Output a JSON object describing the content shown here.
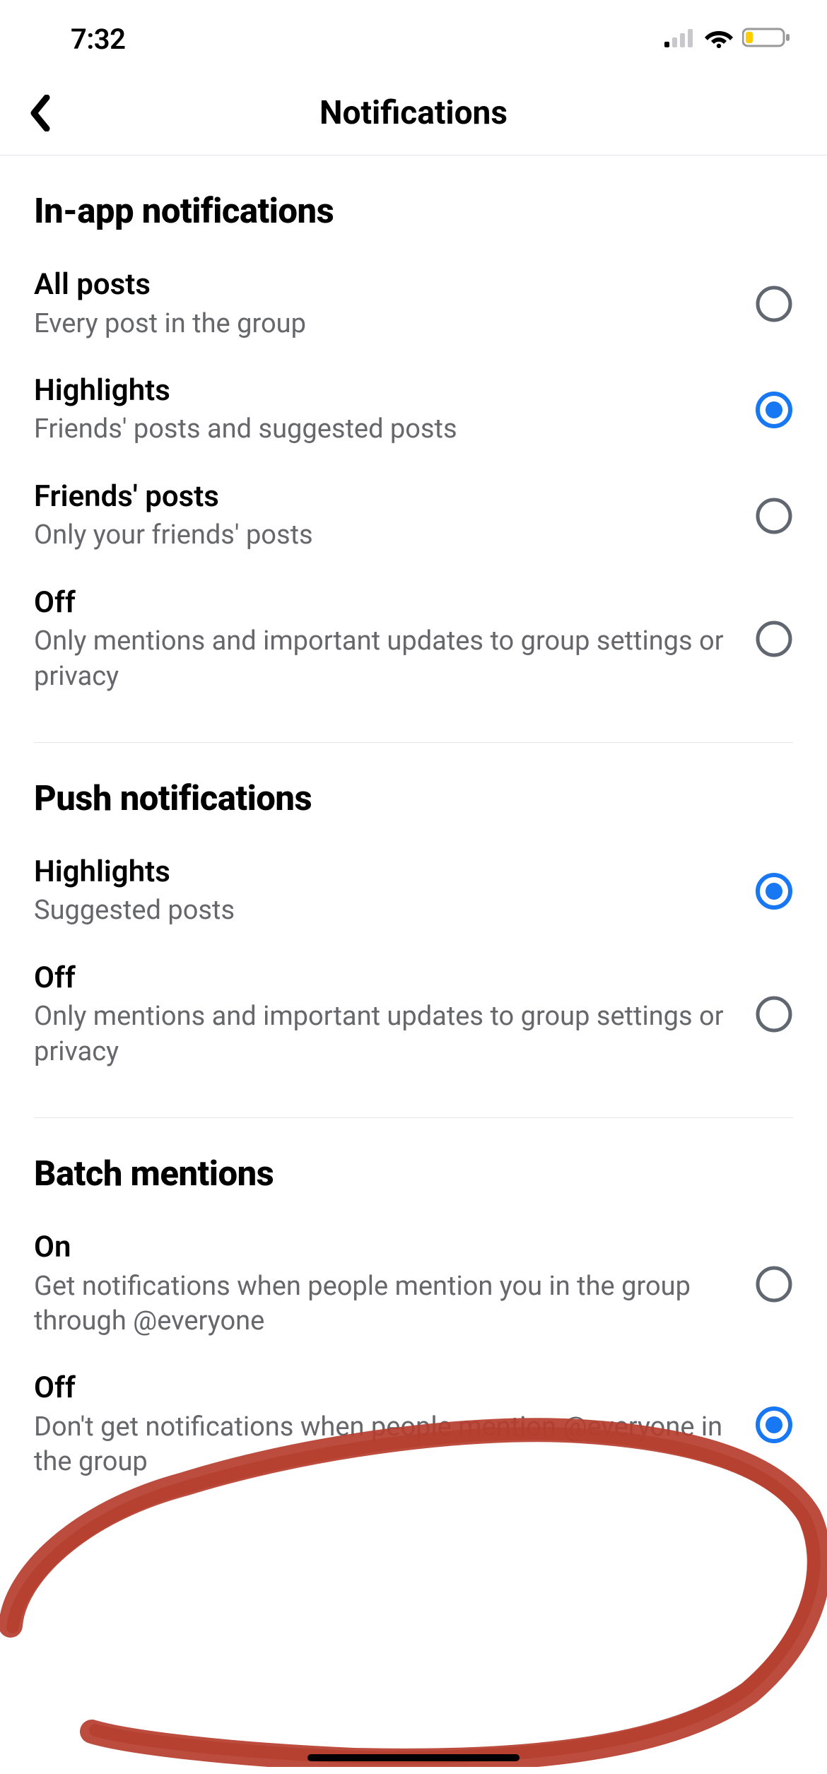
{
  "status": {
    "time": "7:32"
  },
  "nav": {
    "title": "Notifications"
  },
  "sections": {
    "inapp": {
      "title": "In-app notifications",
      "all_posts": {
        "label": "All posts",
        "desc": "Every post in the group",
        "selected": false
      },
      "highlights": {
        "label": "Highlights",
        "desc": "Friends' posts and suggested posts",
        "selected": true
      },
      "friends": {
        "label": "Friends' posts",
        "desc": "Only your friends' posts",
        "selected": false
      },
      "off": {
        "label": "Off",
        "desc": "Only mentions and important updates to group settings or privacy",
        "selected": false
      }
    },
    "push": {
      "title": "Push notifications",
      "highlights": {
        "label": "Highlights",
        "desc": "Suggested posts",
        "selected": true
      },
      "off": {
        "label": "Off",
        "desc": "Only mentions and important updates to group settings or privacy",
        "selected": false
      }
    },
    "batch": {
      "title": "Batch mentions",
      "on": {
        "label": "On",
        "desc": "Get notifications when people mention you in the group through @everyone",
        "selected": false
      },
      "off": {
        "label": "Off",
        "desc": "Don't get notifications when people mention @everyone in the group",
        "selected": true
      }
    }
  },
  "colors": {
    "accent": "#1877F2",
    "text_secondary": "#65676b",
    "radio_border": "#606770",
    "annotation": "#b53d2e"
  }
}
